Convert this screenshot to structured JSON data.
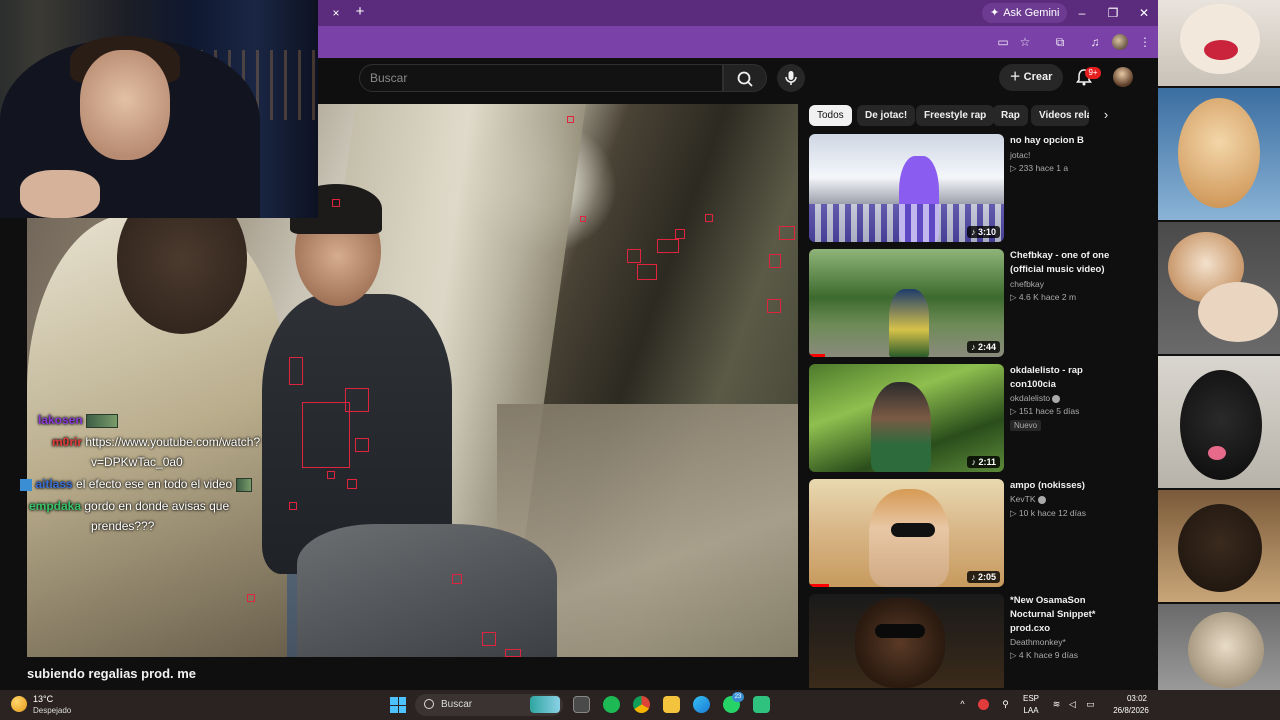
{
  "browser": {
    "tab_close_glyph": "×",
    "new_tab_glyph": "+",
    "gemini_label": "Ask Gemini",
    "window_controls": [
      "–",
      "❐",
      "✕"
    ],
    "toolbar_icons": [
      "cast-icon",
      "star-icon",
      "extensions-icon",
      "media-icon",
      "profile-icon",
      "menu-icon"
    ]
  },
  "youtube": {
    "search_placeholder": "Buscar",
    "create_label": "Crear",
    "notifications_badge": "9+",
    "video_title": "subiendo regalias prod. me",
    "chips": [
      "Todos",
      "De jotac!",
      "Freestyle rap",
      "Rap",
      "Videos rela"
    ],
    "related": [
      {
        "title": "no hay opcion B",
        "channel": "jotac!",
        "meta": "▷ 233  hace 1 a",
        "duration": "♪ 3:10",
        "progress": 0
      },
      {
        "title": "Chefbkay - one of one (official music video)",
        "channel": "chefbkay",
        "meta": "▷ 4.6 K  hace 2 m",
        "duration": "♪ 2:44",
        "progress": 0.08
      },
      {
        "title": "okdalelisto - rap con100cia",
        "channel": "okdalelisto",
        "meta": "▷ 151  hace 5 días",
        "badge": "Nuevo",
        "duration": "♪ 2:11",
        "progress": 0
      },
      {
        "title": "ampo (nokisses)",
        "channel": "KevTK",
        "meta": "▷ 10 k  hace 12 días",
        "duration": "♪ 2:05",
        "progress": 0.1
      },
      {
        "title": "*New OsamaSon Nocturnal Snippet* prod.cxo",
        "channel": "Deathmonkey*",
        "meta": "▷ 4 K  hace 9 días",
        "duration": "",
        "progress": 0
      }
    ]
  },
  "chat": [
    {
      "user": "lakosen",
      "user_color": "#8a3ad6",
      "text": "",
      "emote": true
    },
    {
      "user": "m0rir",
      "user_color": "#e23b3b",
      "text": "https://www.youtube.com/watch?"
    },
    {
      "user": "",
      "user_color": "#ffffff",
      "text": "v=DPKwTac_0a0"
    },
    {
      "user": "aitlass",
      "user_color": "#3a6fd4",
      "text": "el efecto ese en todo el video",
      "emote": true
    },
    {
      "user": "empdaka",
      "user_color": "#38c46a",
      "text": "gordo en donde avisas que"
    },
    {
      "user": "",
      "user_color": "#ffffff",
      "text": "prendes???"
    }
  ],
  "taskbar": {
    "temperature": "13°C",
    "weather": "Despejado",
    "search_label": "Buscar",
    "whatsapp_badge": "23",
    "lang_top": "ESP",
    "lang_bottom": "LAA",
    "time": "03:02",
    "date": "26/8/2026"
  },
  "colors": {
    "tabbar": "#5b2b7e",
    "toolbar": "#7a41a8",
    "yt_background": "#0f0f0f",
    "accent_red": "#ff0000",
    "taskbar": "#2a2321"
  }
}
